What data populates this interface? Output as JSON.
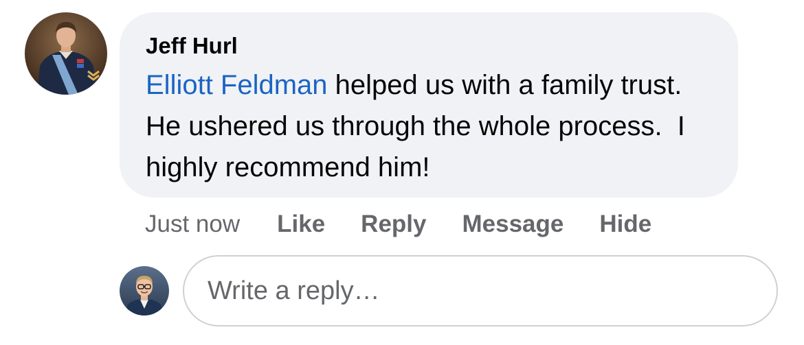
{
  "comment": {
    "author_name": "Jeff Hurl",
    "mention": "Elliott Feldman",
    "text_after_mention": " helped us with a family trust.   He ushered us through the whole process.  I highly recommend him!",
    "colors": {
      "bubble_bg": "#f0f2f5",
      "mention": "#1b64c4",
      "secondary_text": "#65676b"
    }
  },
  "actions": {
    "timestamp": "Just now",
    "like": "Like",
    "reply": "Reply",
    "message": "Message",
    "hide": "Hide"
  },
  "reply_box": {
    "placeholder": "Write a reply…"
  },
  "icons": {
    "author_avatar": "author-avatar-photo",
    "user_avatar": "user-avatar-photo"
  }
}
